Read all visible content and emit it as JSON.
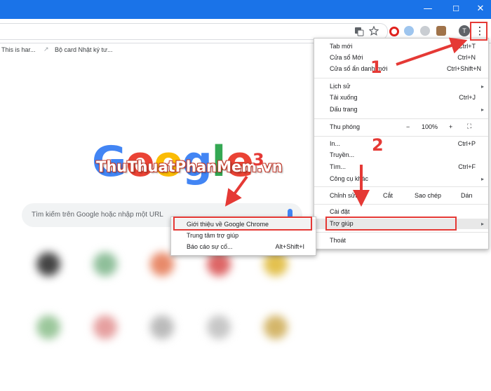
{
  "window": {
    "minimize_glyph": "—",
    "maximize_glyph": "☐",
    "close_glyph": "✕"
  },
  "toolbar": {
    "icons": [
      "translate-icon",
      "star-icon",
      "opera-icon",
      "extension-icon",
      "info-icon",
      "extension-icon",
      "profile-avatar-icon",
      "menu-kebab-icon"
    ],
    "profile_initial": "T",
    "menu_glyph": "⋮"
  },
  "bookmarks": [
    {
      "label": "This is har..."
    },
    {
      "label": "Bộ card Nhật ký tư..."
    }
  ],
  "newtab": {
    "logo_text": "Google",
    "watermark": "ThuThuatPhanMem.vn",
    "search_placeholder": "Tìm kiếm trên Google hoặc nhập một URL"
  },
  "menu": {
    "items": [
      {
        "label": "Tab mới",
        "shortcut": "Ctrl+T"
      },
      {
        "label": "Cửa sổ Mới",
        "shortcut": "Ctrl+N"
      },
      {
        "label": "Cửa sổ ẩn danh mới",
        "shortcut": "Ctrl+Shift+N"
      },
      {
        "label": "Lịch sử",
        "shortcut": ""
      },
      {
        "label": "Tải xuống",
        "shortcut": "Ctrl+J"
      },
      {
        "label": "Dấu trang",
        "shortcut": ""
      },
      {
        "label": "In...",
        "shortcut": "Ctrl+P"
      },
      {
        "label": "Truyền...",
        "shortcut": ""
      },
      {
        "label": "Tìm...",
        "shortcut": "Ctrl+F"
      },
      {
        "label": "Công cụ khác",
        "shortcut": ""
      },
      {
        "label": "Cài đặt",
        "shortcut": ""
      },
      {
        "label": "Trợ giúp",
        "shortcut": ""
      },
      {
        "label": "Thoát",
        "shortcut": ""
      }
    ],
    "zoom": {
      "label": "Thu phóng",
      "minus": "−",
      "value": "100%",
      "plus": "+",
      "fullscreen": "⛶"
    },
    "edit": {
      "label": "Chỉnh sửa",
      "cut": "Cắt",
      "copy": "Sao chép",
      "paste": "Dán"
    },
    "submenu_arrow": "▸"
  },
  "help_submenu": {
    "items": [
      {
        "label": "Giới thiệu về Google Chrome",
        "shortcut": ""
      },
      {
        "label": "Trung tâm trợ giúp",
        "shortcut": ""
      },
      {
        "label": "Báo cáo sự cố...",
        "shortcut": "Alt+Shift+I"
      }
    ]
  },
  "annotations": {
    "step1": "1",
    "step2": "2",
    "step3": "3",
    "color": "#e53935"
  }
}
